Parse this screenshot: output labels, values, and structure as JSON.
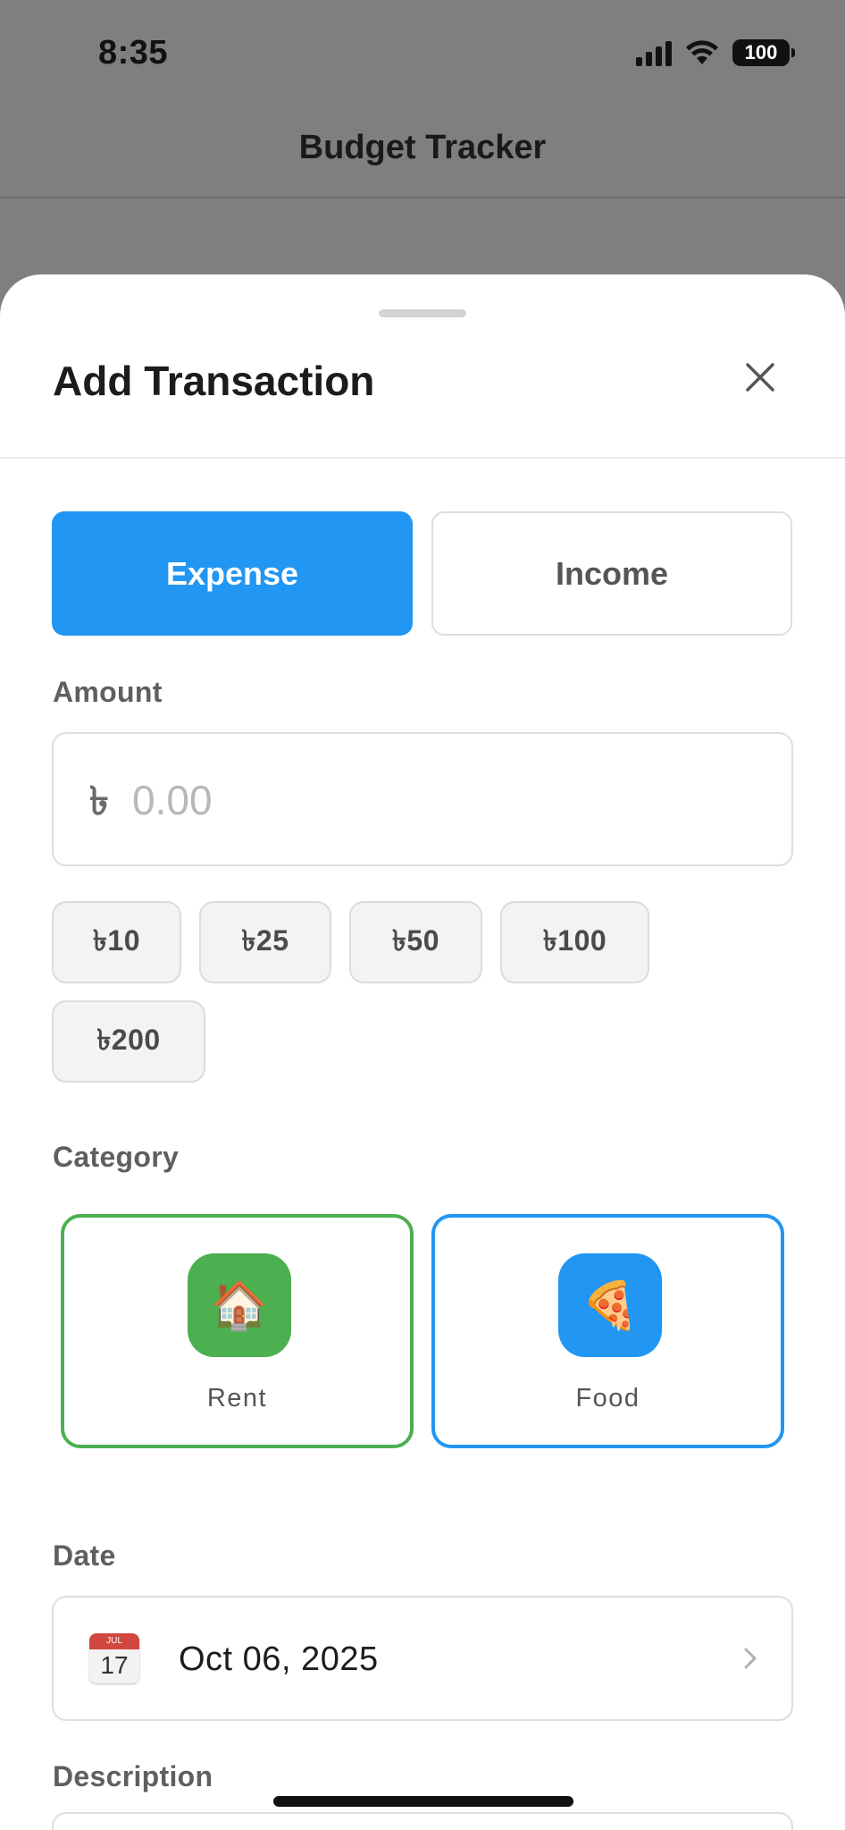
{
  "status_bar": {
    "time": "8:35",
    "battery": "100"
  },
  "nav": {
    "title": "Budget Tracker"
  },
  "sheet": {
    "title": "Add Transaction",
    "close_icon": "close-icon"
  },
  "type_toggle": {
    "expense_label": "Expense",
    "income_label": "Income",
    "selected": "Expense"
  },
  "amount": {
    "label": "Amount",
    "currency_symbol": "৳",
    "value": "",
    "placeholder": "0.00"
  },
  "quick_amounts": [
    "৳10",
    "৳25",
    "৳50",
    "৳100",
    "৳200"
  ],
  "category": {
    "label": "Category",
    "items": [
      {
        "name": "Rent",
        "icon": "🏠",
        "color": "#4caf50"
      },
      {
        "name": "Food",
        "icon": "🍕",
        "color": "#2196f3"
      }
    ]
  },
  "date": {
    "label": "Date",
    "value": "Oct 06, 2025",
    "icon": "calendar-icon",
    "icon_month": "JUL",
    "icon_day": "17"
  },
  "description": {
    "label": "Description"
  },
  "colors": {
    "accent": "#2196f3",
    "rent": "#4caf50",
    "food": "#2196f3"
  }
}
